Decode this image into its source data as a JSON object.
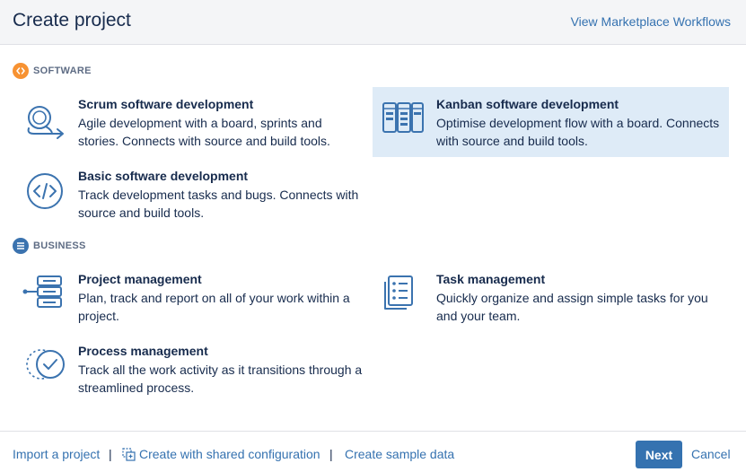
{
  "header": {
    "title": "Create project",
    "marketplace_link": "View Marketplace Workflows"
  },
  "sections": [
    {
      "label": "SOFTWARE",
      "icon": "code-icon",
      "color": "#f79232",
      "templates": [
        {
          "title": "Scrum software development",
          "description": "Agile development with a board, sprints and stories. Connects with source and build tools.",
          "icon": "scrum-cycle-icon",
          "selected": false
        },
        {
          "title": "Kanban software development",
          "description": "Optimise development flow with a board. Connects with source and build tools.",
          "icon": "kanban-board-icon",
          "selected": true
        },
        {
          "title": "Basic software development",
          "description": "Track development tasks and bugs. Connects with source and build tools.",
          "icon": "code-brackets-icon",
          "selected": false
        }
      ]
    },
    {
      "label": "BUSINESS",
      "icon": "list-icon",
      "color": "#3b73af",
      "templates": [
        {
          "title": "Project management",
          "description": "Plan, track and report on all of your work within a project.",
          "icon": "project-stack-icon",
          "selected": false
        },
        {
          "title": "Task management",
          "description": "Quickly organize and assign simple tasks for you and your team.",
          "icon": "task-list-icon",
          "selected": false
        },
        {
          "title": "Process management",
          "description": "Track all the work activity as it transitions through a streamlined process.",
          "icon": "process-check-icon",
          "selected": false
        }
      ]
    }
  ],
  "footer": {
    "import_link": "Import a project",
    "shared_config_link": "Create with shared configuration",
    "sample_data_link": "Create sample data",
    "separator": "|",
    "next_label": "Next",
    "cancel_label": "Cancel"
  },
  "colors": {
    "link": "#3572b0",
    "primary_button": "#3572b0",
    "selected_tile": "#deebf7",
    "icon_stroke": "#3b73af"
  }
}
